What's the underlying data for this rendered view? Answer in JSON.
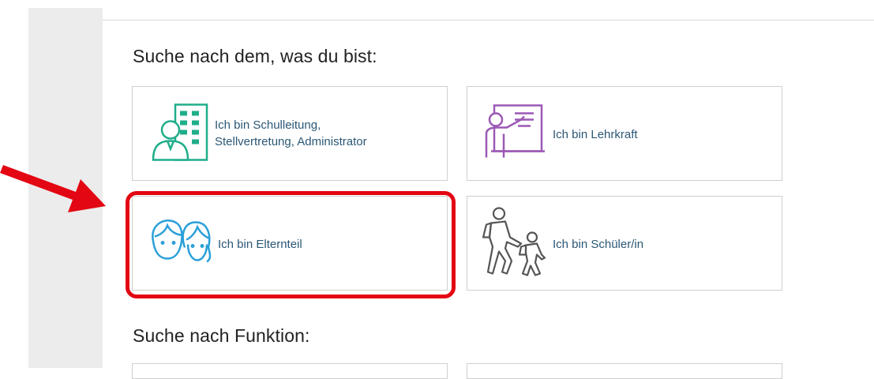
{
  "sections": {
    "role_title": "Suche nach dem, was du bist:",
    "function_title": "Suche nach Funktion:"
  },
  "cards": [
    {
      "label": "Ich bin Schulleitung,\nStellvertretung, Administrator",
      "icon": "school-admin-icon",
      "color": "#1fae8a"
    },
    {
      "label": "Ich bin Lehrkraft",
      "icon": "teacher-icon",
      "color": "#9b59b6"
    },
    {
      "label": "Ich bin Elternteil",
      "icon": "parents-icon",
      "color": "#2a9fd8"
    },
    {
      "label": "Ich bin Schüler/in",
      "icon": "student-icon",
      "color": "#555555"
    }
  ],
  "annotation": {
    "highlight_color": "#e30613",
    "arrow_color": "#e30613"
  }
}
